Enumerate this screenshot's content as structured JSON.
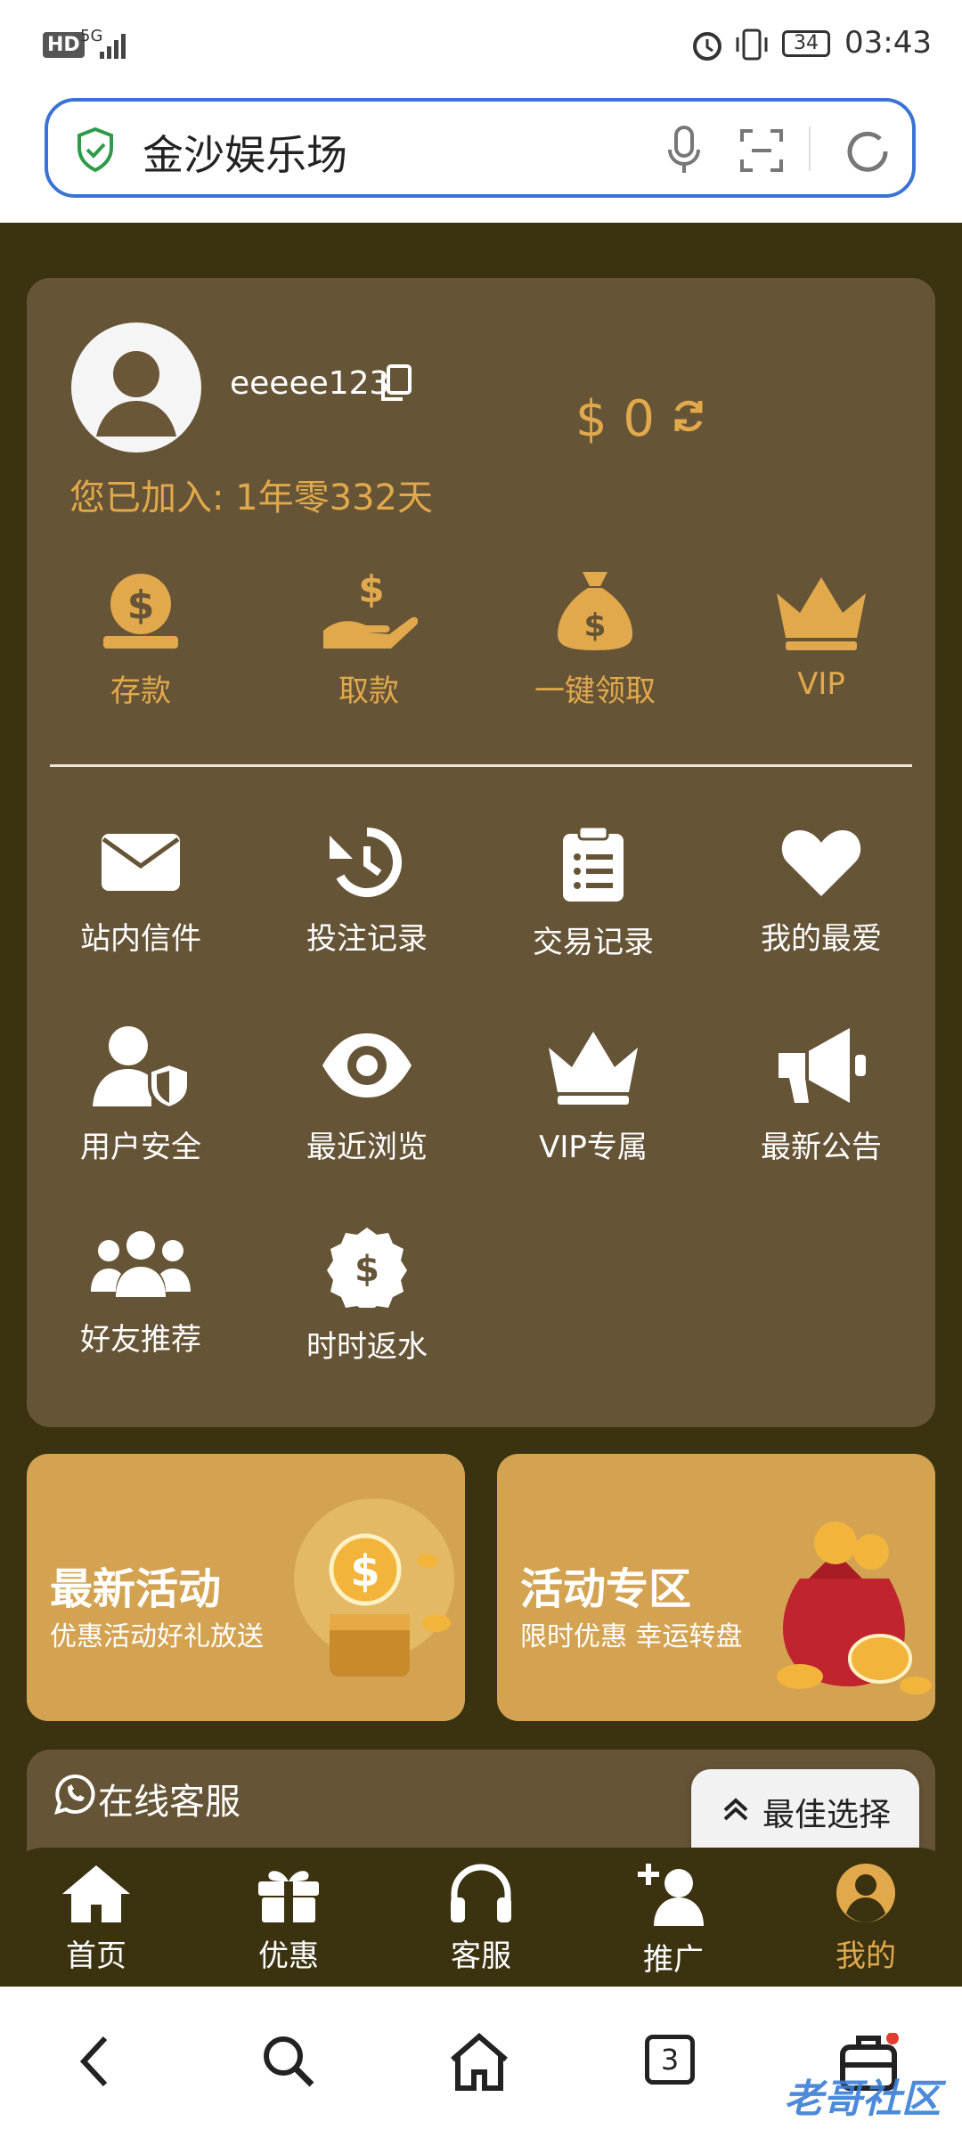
{
  "status_bar": {
    "hd": "HD",
    "network": "5G",
    "battery": "34",
    "time": "03:43"
  },
  "browser": {
    "address_text": "金沙娱乐场",
    "tab_count": "3"
  },
  "profile": {
    "username": "eeeee123",
    "balance": "$ 0",
    "joined": "您已加入: 1年零332天"
  },
  "quick_actions": [
    {
      "label": "存款",
      "icon": "deposit-icon"
    },
    {
      "label": "取款",
      "icon": "withdraw-icon"
    },
    {
      "label": "一键领取",
      "icon": "money-bag-icon"
    },
    {
      "label": "VIP",
      "icon": "crown-icon"
    }
  ],
  "menu": [
    {
      "label": "站内信件",
      "icon": "mail-icon"
    },
    {
      "label": "投注记录",
      "icon": "history-icon"
    },
    {
      "label": "交易记录",
      "icon": "clipboard-list-icon"
    },
    {
      "label": "我的最爱",
      "icon": "heart-icon"
    },
    {
      "label": "用户安全",
      "icon": "user-shield-icon"
    },
    {
      "label": "最近浏览",
      "icon": "eye-icon"
    },
    {
      "label": "VIP专属",
      "icon": "crown-icon"
    },
    {
      "label": "最新公告",
      "icon": "megaphone-icon"
    },
    {
      "label": "好友推荐",
      "icon": "users-icon"
    },
    {
      "label": "时时返水",
      "icon": "coin-badge-icon"
    }
  ],
  "promos": [
    {
      "title": "最新活动",
      "subtitle": "优惠活动好礼放送"
    },
    {
      "title": "活动专区",
      "subtitle": "限时优惠 幸运转盘"
    }
  ],
  "service": {
    "label": "在线客服",
    "best_choice": "最佳选择"
  },
  "tabs": [
    {
      "label": "首页",
      "icon": "home-icon"
    },
    {
      "label": "优惠",
      "icon": "gift-icon"
    },
    {
      "label": "客服",
      "icon": "headset-icon"
    },
    {
      "label": "推广",
      "icon": "user-plus-icon"
    },
    {
      "label": "我的",
      "icon": "user-circle-icon",
      "active": true
    }
  ],
  "watermark": "老哥社区",
  "colors": {
    "gold": "#e1a94b",
    "card": "#665437",
    "bg": "#3b3210",
    "promo": "#d3a352",
    "accent": "#3a72d6"
  }
}
